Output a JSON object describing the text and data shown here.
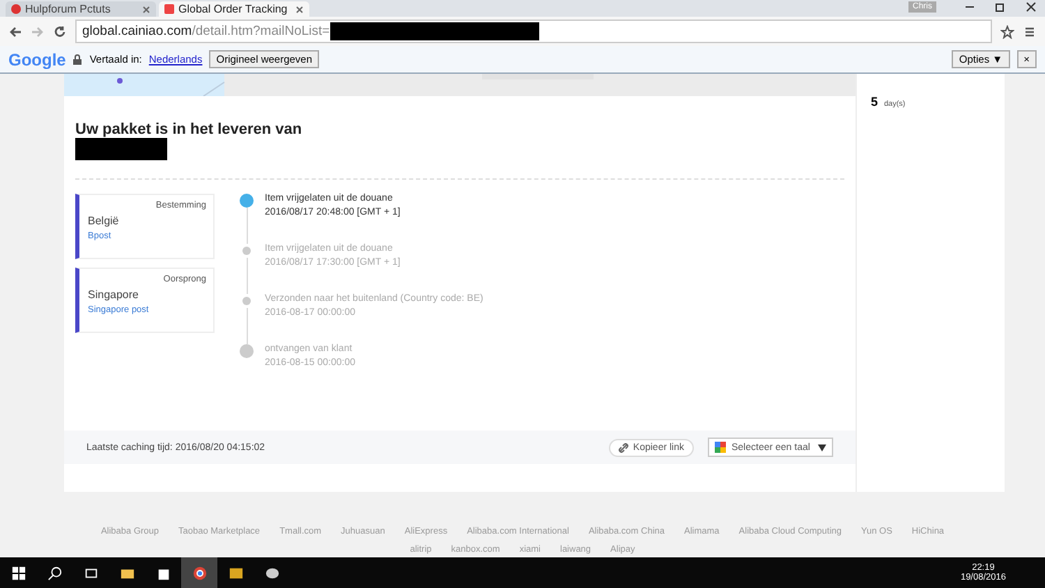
{
  "browser": {
    "tabs": [
      {
        "title": "Hulpforum Pctuts",
        "selected": false
      },
      {
        "title": "Global Order Tracking",
        "selected": true
      }
    ],
    "user": "Chris",
    "url_host": "global.cainiao.com",
    "url_path": "/detail.htm?mailNoList="
  },
  "translate_bar": {
    "logo": "Google",
    "label": "Vertaald in:",
    "language": "Nederlands",
    "original_button": "Origineel weergeven",
    "options_button": "Opties ▼",
    "close": "×"
  },
  "tracking": {
    "heading": "Uw pakket is in het leveren van",
    "locations": [
      {
        "role": "Bestemming",
        "country": "België",
        "carrier": "Bpost"
      },
      {
        "role": "Oorsprong",
        "country": "Singapore",
        "carrier": "Singapore post"
      }
    ],
    "events": [
      {
        "kind": "current",
        "status": "Item vrijgelaten uit de douane",
        "time": "2016/08/17 20:48:00 [GMT + 1]"
      },
      {
        "kind": "step",
        "status": "Item vrijgelaten uit de douane",
        "time": "2016/08/17 17:30:00 [GMT + 1]"
      },
      {
        "kind": "step",
        "status": "Verzonden naar het buitenland (Country code: BE)",
        "time": "2016-08-17 00:00:00"
      },
      {
        "kind": "origin",
        "status": "ontvangen van klant",
        "time": "2016-08-15 00:00:00"
      }
    ],
    "cache_time": "Laatste caching tijd: 2016/08/20 04:15:02",
    "copy_link": "Kopieer link",
    "language_select": "Selecteer een taal"
  },
  "sidebar": {
    "days": "5",
    "days_unit": "day(s)"
  },
  "footer": {
    "links": [
      "Alibaba Group",
      "Taobao Marketplace",
      "Tmall.com",
      "Juhuasuan",
      "AliExpress",
      "Alibaba.com International",
      "Alibaba.com China",
      "Alimama",
      "Alibaba Cloud Computing",
      "Yun OS",
      "HiChina"
    ],
    "links_2": [
      "alitrip",
      "kanbox.com",
      "xiami",
      "laiwang",
      "Alipay"
    ]
  },
  "taskbar": {
    "apps": [
      {
        "kind": "explorer",
        "selected": false
      },
      {
        "kind": "store",
        "selected": false
      },
      {
        "kind": "chrome",
        "selected": true
      },
      {
        "kind": "app",
        "selected": false
      },
      {
        "kind": "paint",
        "selected": false
      }
    ],
    "time": "22:19",
    "date": "19/08/2016"
  }
}
